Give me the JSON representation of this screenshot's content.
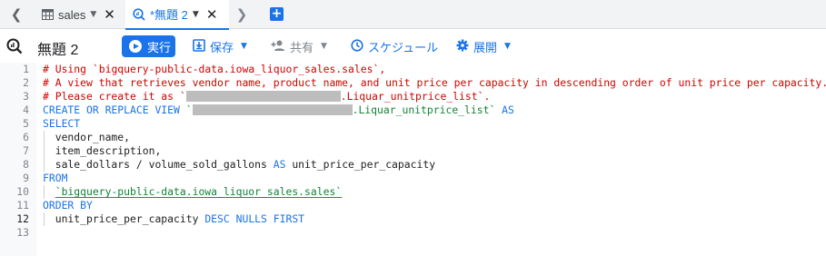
{
  "tabs": [
    {
      "label": "sales",
      "active": false
    },
    {
      "label": "*無題 2",
      "active": true
    }
  ],
  "toolbar": {
    "query_title": "無題 2",
    "run_label": "実行",
    "save_label": "保存",
    "share_label": "共有",
    "schedule_label": "スケジュール",
    "deploy_label": "展開"
  },
  "editor": {
    "lines": [
      {
        "n": "1",
        "parts": [
          {
            "t": "# Using ",
            "c": "cmt"
          },
          {
            "t": "`bigquery-public-data.iowa_liquor_sales.sales`",
            "c": "cmt"
          },
          {
            "t": ",",
            "c": "cmt"
          }
        ]
      },
      {
        "n": "2",
        "parts": [
          {
            "t": "# A view that retrieves vendor name, product name, and unit price per capacity in descending order of unit price per capacity.",
            "c": "cmt"
          }
        ]
      },
      {
        "n": "3",
        "parts": [
          {
            "t": "# Please create it as `",
            "c": "cmt"
          },
          {
            "redact": 170
          },
          {
            "t": ".Liquar_unitprice_list`.",
            "c": "cmt"
          }
        ]
      },
      {
        "n": "4",
        "parts": [
          {
            "t": "CREATE OR REPLACE VIEW ",
            "c": "kw"
          },
          {
            "t": "`",
            "c": "str"
          },
          {
            "redact": 176
          },
          {
            "t": ".Liquar_unitprice_list`",
            "c": "str"
          },
          {
            "t": " AS",
            "c": "kw"
          }
        ]
      },
      {
        "n": "5",
        "parts": [
          {
            "t": "SELECT",
            "c": "kw"
          }
        ]
      },
      {
        "n": "6",
        "parts": [
          {
            "t": "  vendor_name,",
            "c": ""
          }
        ]
      },
      {
        "n": "7",
        "parts": [
          {
            "t": "  item_description,",
            "c": ""
          }
        ]
      },
      {
        "n": "8",
        "parts": [
          {
            "t": "  sale_dollars / volume_sold_gallons ",
            "c": ""
          },
          {
            "t": "AS",
            "c": "kw"
          },
          {
            "t": " unit_price_per_capacity",
            "c": ""
          }
        ]
      },
      {
        "n": "9",
        "parts": [
          {
            "t": "FROM",
            "c": "kw"
          }
        ]
      },
      {
        "n": "10",
        "parts": [
          {
            "t": "  ",
            "c": ""
          },
          {
            "t": "`bigquery-public-data.iowa_liquor_sales.sales`",
            "c": "str uline"
          }
        ]
      },
      {
        "n": "11",
        "parts": [
          {
            "t": "ORDER BY",
            "c": "kw"
          }
        ]
      },
      {
        "n": "12",
        "parts": [
          {
            "t": "  unit_price_per_capacity ",
            "c": ""
          },
          {
            "t": "DESC NULLS FIRST",
            "c": "kw"
          }
        ]
      },
      {
        "n": "13",
        "parts": []
      }
    ],
    "active_line": "12"
  },
  "colors": {
    "accent": "#1a73e8",
    "comment": "#d50000",
    "string": "#188038"
  }
}
